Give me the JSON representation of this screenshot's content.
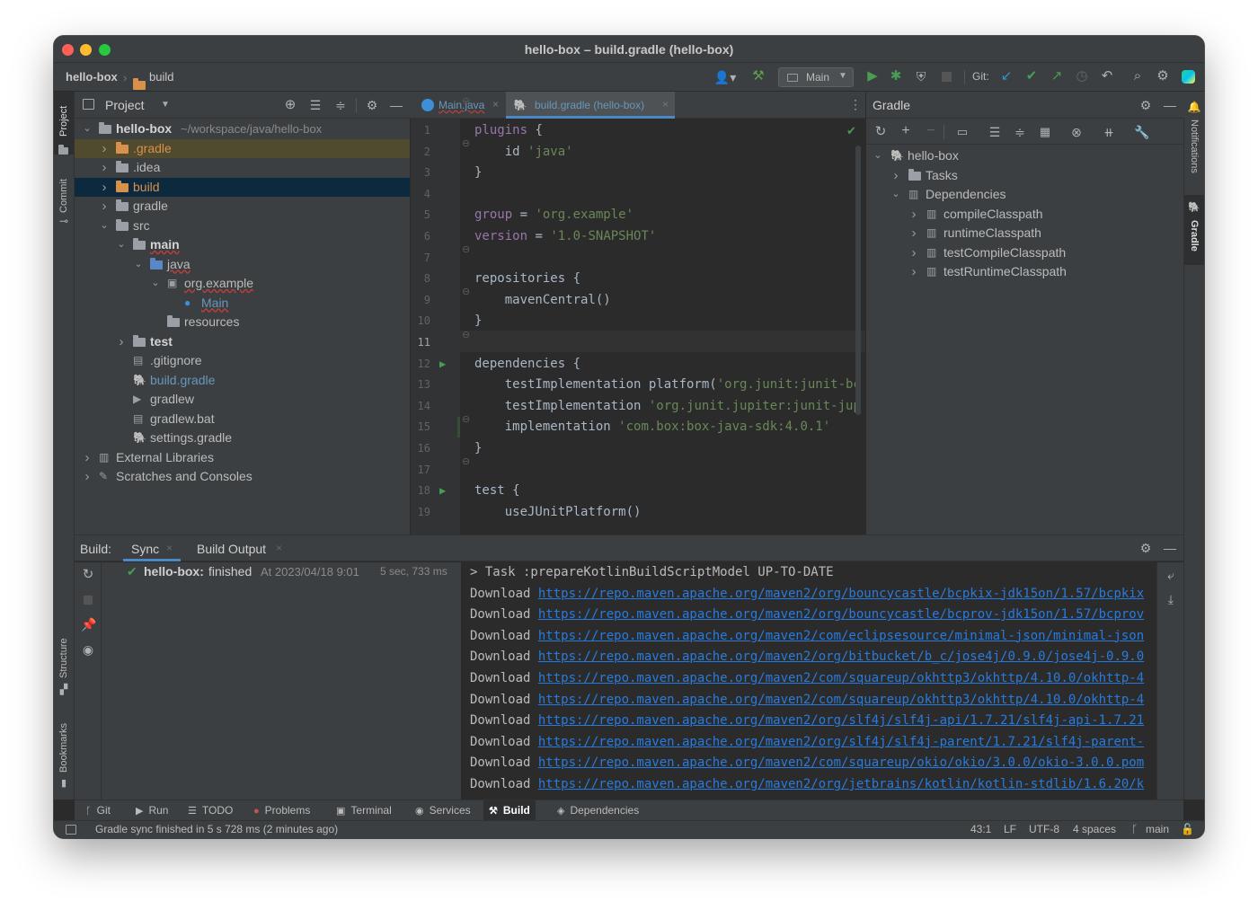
{
  "window": {
    "title": "hello-box – build.gradle (hello-box)"
  },
  "breadcrumb": {
    "project": "hello-box",
    "folder": "build"
  },
  "toolbar": {
    "run_config": "Main",
    "git_label": "Git:"
  },
  "left_strip": {
    "project": "Project",
    "commit": "Commit",
    "structure": "Structure",
    "bookmarks": "Bookmarks"
  },
  "right_strip": {
    "notifications": "Notifications",
    "gradle": "Gradle"
  },
  "project_panel": {
    "title": "Project",
    "tree": [
      {
        "label": "hello-box",
        "suffix": "~/workspace/java/hello-box",
        "depth": 0,
        "arrow": "down",
        "icon": "folder-grey",
        "bold": true
      },
      {
        "label": ".gradle",
        "depth": 1,
        "arrow": "right",
        "icon": "folder-orange",
        "highlight": "orange"
      },
      {
        "label": ".idea",
        "depth": 1,
        "arrow": "right",
        "icon": "folder-grey"
      },
      {
        "label": "build",
        "depth": 1,
        "arrow": "right",
        "icon": "folder-orange",
        "highlight": "selected"
      },
      {
        "label": "gradle",
        "depth": 1,
        "arrow": "right",
        "icon": "folder-grey"
      },
      {
        "label": "src",
        "depth": 1,
        "arrow": "down",
        "icon": "folder-grey"
      },
      {
        "label": "main",
        "depth": 2,
        "arrow": "down",
        "icon": "folder-grey",
        "bold": true
      },
      {
        "label": "java",
        "depth": 3,
        "arrow": "down",
        "icon": "folder-blue"
      },
      {
        "label": "org.example",
        "depth": 4,
        "arrow": "down",
        "icon": "package"
      },
      {
        "label": "Main",
        "depth": 5,
        "arrow": "",
        "icon": "class",
        "color": "#6897bb"
      },
      {
        "label": "resources",
        "depth": 4,
        "arrow": "",
        "icon": "folder-grey"
      },
      {
        "label": "test",
        "depth": 2,
        "arrow": "right",
        "icon": "folder-grey",
        "bold": true
      },
      {
        "label": ".gitignore",
        "depth": 2,
        "arrow": "",
        "icon": "file"
      },
      {
        "label": "build.gradle",
        "depth": 2,
        "arrow": "",
        "icon": "gradle",
        "color": "#6897bb"
      },
      {
        "label": "gradlew",
        "depth": 2,
        "arrow": "",
        "icon": "exec"
      },
      {
        "label": "gradlew.bat",
        "depth": 2,
        "arrow": "",
        "icon": "file"
      },
      {
        "label": "settings.gradle",
        "depth": 2,
        "arrow": "",
        "icon": "gradle"
      },
      {
        "label": "External Libraries",
        "depth": 0,
        "arrow": "right",
        "icon": "libraries"
      },
      {
        "label": "Scratches and Consoles",
        "depth": 0,
        "arrow": "right",
        "icon": "scratches"
      }
    ]
  },
  "editor": {
    "tabs": [
      {
        "label": "Main.java",
        "active": false
      },
      {
        "label": "build.gradle (hello-box)",
        "active": true
      }
    ],
    "lines": [
      {
        "n": "1",
        "html": "<span class=\"purple\">plugins</span> {"
      },
      {
        "n": "2",
        "html": "    id <span class=\"str\">'java'</span>"
      },
      {
        "n": "3",
        "html": "}"
      },
      {
        "n": "4",
        "html": ""
      },
      {
        "n": "5",
        "html": "<span class=\"purple\">group</span> = <span class=\"str\">'org.example'</span>"
      },
      {
        "n": "6",
        "html": "<span class=\"purple\">version</span> = <span class=\"str\">'1.0-SNAPSHOT'</span>"
      },
      {
        "n": "7",
        "html": ""
      },
      {
        "n": "8",
        "html": "repositories {"
      },
      {
        "n": "9",
        "html": "    mavenCentral()"
      },
      {
        "n": "10",
        "html": "}"
      },
      {
        "n": "11",
        "html": ""
      },
      {
        "n": "12",
        "html": "dependencies {"
      },
      {
        "n": "13",
        "html": "    testImplementation platform(<span class=\"str\">'org.junit:junit-bc</span>"
      },
      {
        "n": "14",
        "html": "    testImplementation <span class=\"str\">'org.junit.jupiter:junit-jup</span>"
      },
      {
        "n": "15",
        "html": "    implementation <span class=\"str\">'com.box:box-java-sdk:4.0.1'</span>"
      },
      {
        "n": "16",
        "html": "}"
      },
      {
        "n": "17",
        "html": ""
      },
      {
        "n": "18",
        "html": "test {"
      },
      {
        "n": "19",
        "html": "    useJUnitPlatform()"
      }
    ]
  },
  "gradle_panel": {
    "title": "Gradle",
    "tree": [
      {
        "label": "hello-box",
        "depth": 0,
        "arrow": "down"
      },
      {
        "label": "Tasks",
        "depth": 1,
        "arrow": "right"
      },
      {
        "label": "Dependencies",
        "depth": 1,
        "arrow": "down"
      },
      {
        "label": "compileClasspath",
        "depth": 2,
        "arrow": "right"
      },
      {
        "label": "runtimeClasspath",
        "depth": 2,
        "arrow": "right"
      },
      {
        "label": "testCompileClasspath",
        "depth": 2,
        "arrow": "right"
      },
      {
        "label": "testRuntimeClasspath",
        "depth": 2,
        "arrow": "right"
      }
    ]
  },
  "build_panel": {
    "label": "Build:",
    "tabs": [
      "Sync",
      "Build Output"
    ],
    "result_title": "hello-box:",
    "result_status": "finished",
    "result_time": "At 2023/04/18 9:01",
    "result_duration": "5 sec, 733 ms",
    "console": [
      {
        "prefix": "> Task :prepareKotlinBuildScriptModel UP-TO-DATE",
        "link": ""
      },
      {
        "prefix": "Download ",
        "link": "https://repo.maven.apache.org/maven2/org/bouncycastle/bcpkix-jdk15on/1.57/bcpkix"
      },
      {
        "prefix": "Download ",
        "link": "https://repo.maven.apache.org/maven2/org/bouncycastle/bcprov-jdk15on/1.57/bcprov"
      },
      {
        "prefix": "Download ",
        "link": "https://repo.maven.apache.org/maven2/com/eclipsesource/minimal-json/minimal-json"
      },
      {
        "prefix": "Download ",
        "link": "https://repo.maven.apache.org/maven2/org/bitbucket/b_c/jose4j/0.9.0/jose4j-0.9.0"
      },
      {
        "prefix": "Download ",
        "link": "https://repo.maven.apache.org/maven2/com/squareup/okhttp3/okhttp/4.10.0/okhttp-4"
      },
      {
        "prefix": "Download ",
        "link": "https://repo.maven.apache.org/maven2/com/squareup/okhttp3/okhttp/4.10.0/okhttp-4"
      },
      {
        "prefix": "Download ",
        "link": "https://repo.maven.apache.org/maven2/org/slf4j/slf4j-api/1.7.21/slf4j-api-1.7.21"
      },
      {
        "prefix": "Download ",
        "link": "https://repo.maven.apache.org/maven2/org/slf4j/slf4j-parent/1.7.21/slf4j-parent-"
      },
      {
        "prefix": "Download ",
        "link": "https://repo.maven.apache.org/maven2/com/squareup/okio/okio/3.0.0/okio-3.0.0.pom"
      },
      {
        "prefix": "Download ",
        "link": "https://repo.maven.apache.org/maven2/org/jetbrains/kotlin/kotlin-stdlib/1.6.20/k"
      }
    ]
  },
  "bottom_toolbar": [
    {
      "label": "Git",
      "icon": "git-branch-icon"
    },
    {
      "label": "Run",
      "icon": "run-icon"
    },
    {
      "label": "TODO",
      "icon": "todo-icon"
    },
    {
      "label": "Problems",
      "icon": "problems-icon"
    },
    {
      "label": "Terminal",
      "icon": "terminal-icon"
    },
    {
      "label": "Services",
      "icon": "services-icon"
    },
    {
      "label": "Build",
      "icon": "hammer-icon",
      "active": true
    },
    {
      "label": "Dependencies",
      "icon": "dependencies-icon"
    }
  ],
  "status_bar": {
    "message": "Gradle sync finished in 5 s 728 ms (2 minutes ago)",
    "position": "43:1",
    "line_sep": "LF",
    "encoding": "UTF-8",
    "indent": "4 spaces",
    "branch": "main"
  },
  "colors": {
    "accent": "#287bde",
    "selection": "#0d293e",
    "green": "#499c54",
    "orange_folder": "#d8914b"
  }
}
